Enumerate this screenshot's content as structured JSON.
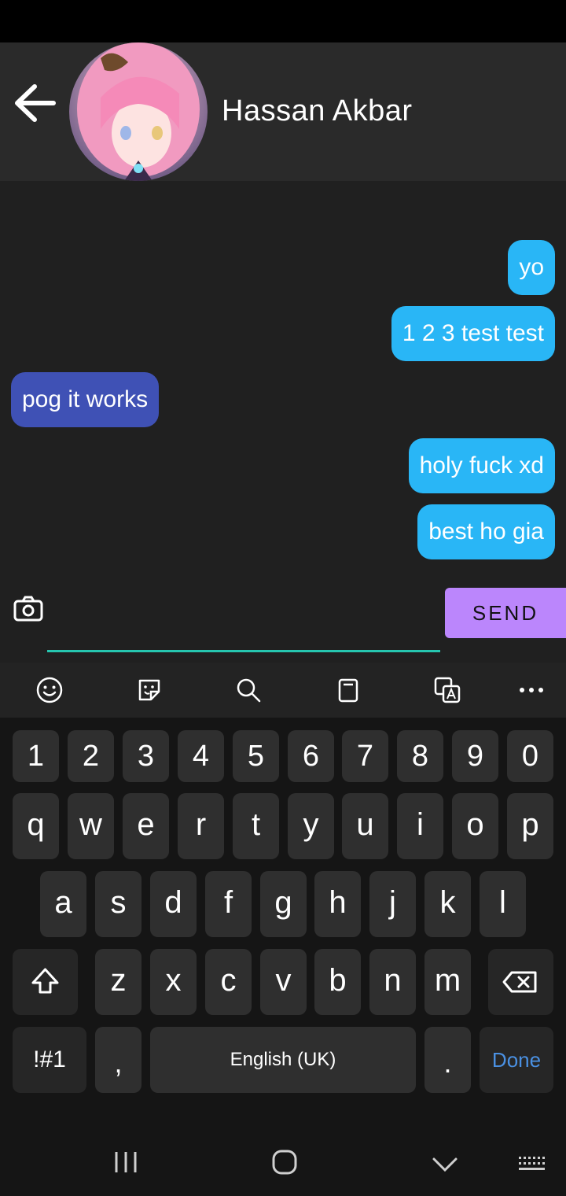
{
  "header": {
    "contact_name": "Hassan Akbar",
    "avatar_description_icon": "anime-avatar-image"
  },
  "messages": [
    {
      "text": "yo",
      "direction": "out"
    },
    {
      "text": "1 2 3 test test",
      "direction": "out"
    },
    {
      "text": "pog it works",
      "direction": "in"
    },
    {
      "text": "holy fuck xd",
      "direction": "out"
    },
    {
      "text": "best ho gia",
      "direction": "out"
    }
  ],
  "composer": {
    "input_value": "",
    "send_label": "SEND"
  },
  "keyboard": {
    "row_numbers": [
      "1",
      "2",
      "3",
      "4",
      "5",
      "6",
      "7",
      "8",
      "9",
      "0"
    ],
    "row_q": [
      "q",
      "w",
      "e",
      "r",
      "t",
      "y",
      "u",
      "i",
      "o",
      "p"
    ],
    "row_a": [
      "a",
      "s",
      "d",
      "f",
      "g",
      "h",
      "j",
      "k",
      "l"
    ],
    "row_z": [
      "z",
      "x",
      "c",
      "v",
      "b",
      "n",
      "m"
    ],
    "symbols_label": "!#1",
    "comma_label": ",",
    "space_label": "English (UK)",
    "period_label": ".",
    "done_label": "Done"
  },
  "colors": {
    "outgoing_bubble": "#29b6f6",
    "incoming_bubble": "#3f51b5",
    "send_button": "#bb86fc",
    "input_underline": "#26c6b0",
    "done_text": "#4a90e2"
  }
}
